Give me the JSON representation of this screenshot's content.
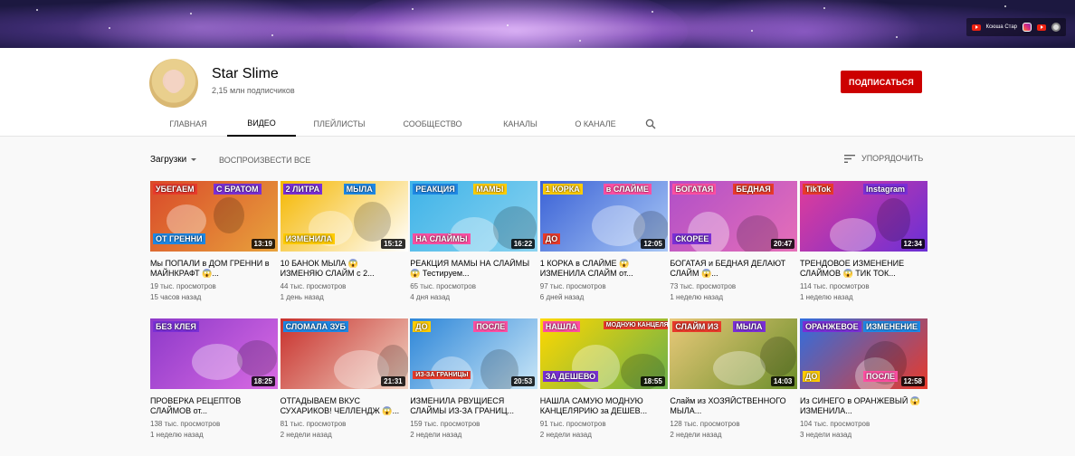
{
  "banner": {
    "links": {
      "channel_label": "Ксюша Стар"
    }
  },
  "channel": {
    "name": "Star Slime",
    "subscribers": "2,15 млн подписчиков",
    "subscribe_label": "ПОДПИСАТЬСЯ",
    "tabs": [
      {
        "label": "ГЛАВНАЯ",
        "active": false
      },
      {
        "label": "ВИДЕО",
        "active": true
      },
      {
        "label": "ПЛЕЙЛИСТЫ",
        "active": false
      },
      {
        "label": "СООБЩЕСТВО",
        "active": false
      },
      {
        "label": "КАНАЛЫ",
        "active": false
      },
      {
        "label": "О КАНАЛЕ",
        "active": false
      }
    ]
  },
  "toolbar": {
    "uploads_label": "Загрузки",
    "play_all_label": "ВОСПРОИЗВЕСТИ ВСЕ",
    "sort_label": "УПОРЯДОЧИТЬ"
  },
  "videos": [
    {
      "title": "Мы ПОПАЛИ в ДОМ ГРЕННИ в МАЙНКРАФТ 😱...",
      "views": "19 тыс. просмотров",
      "age": "15 часов назад",
      "duration": "13:19",
      "thumb_text": [
        "УБЕГАЕМ",
        "С БРАТОМ",
        "ОТ ГРЕННИ"
      ],
      "colors": [
        "#d94a2a",
        "#e8a23c"
      ]
    },
    {
      "title": "10 БАНОК МЫЛА 😱 ИЗМЕНЯЮ СЛАЙМ с 2...",
      "views": "44 тыс. просмотров",
      "age": "1 день назад",
      "duration": "15:12",
      "thumb_text": [
        "2 ЛИТРА",
        "МЫЛА",
        "ИЗМЕНИЛА"
      ],
      "colors": [
        "#f5b700",
        "#ffffff"
      ]
    },
    {
      "title": "РЕАКЦИЯ МАМЫ НА СЛАЙМЫ 😱 Тестируем...",
      "views": "65 тыс. просмотров",
      "age": "4 дня назад",
      "duration": "16:22",
      "thumb_text": [
        "РЕАКЦИЯ",
        "МАМЫ",
        "НА СЛАЙМЫ"
      ],
      "colors": [
        "#3fb3e8",
        "#8ad3f0"
      ]
    },
    {
      "title": "1 КОРКА в СЛАЙМЕ 😱 ИЗМЕНИЛА СЛАЙМ от...",
      "views": "97 тыс. просмотров",
      "age": "6 дней назад",
      "duration": "12:05",
      "thumb_text": [
        "1 КОРКА",
        "в СЛАЙМЕ",
        "ДО"
      ],
      "colors": [
        "#3b62d6",
        "#a8c7f5"
      ]
    },
    {
      "title": "БОГАТАЯ и БЕДНАЯ ДЕЛАЮТ СЛАЙМ 😱...",
      "views": "73 тыс. просмотров",
      "age": "1 неделю назад",
      "duration": "20:47",
      "thumb_text": [
        "БОГАТАЯ",
        "БЕДНАЯ",
        "СКОРЕЕ"
      ],
      "colors": [
        "#b04fc8",
        "#e66fb8"
      ]
    },
    {
      "title": "ТРЕНДОВОЕ ИЗМЕНЕНИЕ СЛАЙМОВ 😱 ТИК ТОК...",
      "views": "114 тыс. просмотров",
      "age": "1 неделю назад",
      "duration": "12:34",
      "thumb_text": [
        "TikTok",
        "Instagram"
      ],
      "colors": [
        "#e03c9a",
        "#6a2fd6"
      ]
    },
    {
      "title": "ПРОВЕРКА РЕЦЕПТОВ СЛАЙМОВ от...",
      "views": "138 тыс. просмотров",
      "age": "1 неделю назад",
      "duration": "18:25",
      "thumb_text": [
        "БЕЗ КЛЕЯ"
      ],
      "colors": [
        "#8d39c9",
        "#d96be3"
      ]
    },
    {
      "title": "ОТГАДЫВАЕМ ВКУС СУХАРИКОВ! ЧЕЛЛЕНДЖ 😱...",
      "views": "81 тыс. просмотров",
      "age": "2 недели назад",
      "duration": "21:31",
      "thumb_text": [
        "СЛОМАЛА ЗУБ"
      ],
      "colors": [
        "#c8302c",
        "#f0d2c2"
      ]
    },
    {
      "title": "ИЗМЕНИЛА РВУЩИЕСЯ СЛАЙМЫ ИЗ-ЗА ГРАНИЦ...",
      "views": "159 тыс. просмотров",
      "age": "2 недели назад",
      "duration": "20:53",
      "thumb_text": [
        "ДО",
        "ПОСЛЕ",
        "ИЗ-ЗА ГРАНИЦЫ"
      ],
      "colors": [
        "#2d86d8",
        "#c9e6f7"
      ]
    },
    {
      "title": "НАШЛА САМУЮ МОДНУЮ КАНЦЕЛЯРИЮ за ДЕШЕВ...",
      "views": "91 тыс. просмотров",
      "age": "2 недели назад",
      "duration": "18:55",
      "thumb_text": [
        "НАШЛА",
        "МОДНУЮ КАНЦЕЛЯРИЮ",
        "ЗА ДЕШЕВО"
      ],
      "colors": [
        "#ffd800",
        "#6ab04c"
      ]
    },
    {
      "title": "Слайм из ХОЗЯЙСТВЕННОГО МЫЛА...",
      "views": "128 тыс. просмотров",
      "age": "2 недели назад",
      "duration": "14:03",
      "thumb_text": [
        "СЛАЙМ ИЗ",
        "МЫЛА"
      ],
      "colors": [
        "#e9c97a",
        "#6b8e2a"
      ]
    },
    {
      "title": "Из СИНЕГО в ОРАНЖЕВЫЙ 😱 ИЗМЕНИЛА...",
      "views": "104 тыс. просмотров",
      "age": "3 недели назад",
      "duration": "12:58",
      "thumb_text": [
        "ОРАНЖЕВОЕ",
        "ИЗМЕНЕНИЕ",
        "ДО",
        "ПОСЛЕ"
      ],
      "colors": [
        "#2f6ee0",
        "#e83a2b"
      ]
    }
  ]
}
